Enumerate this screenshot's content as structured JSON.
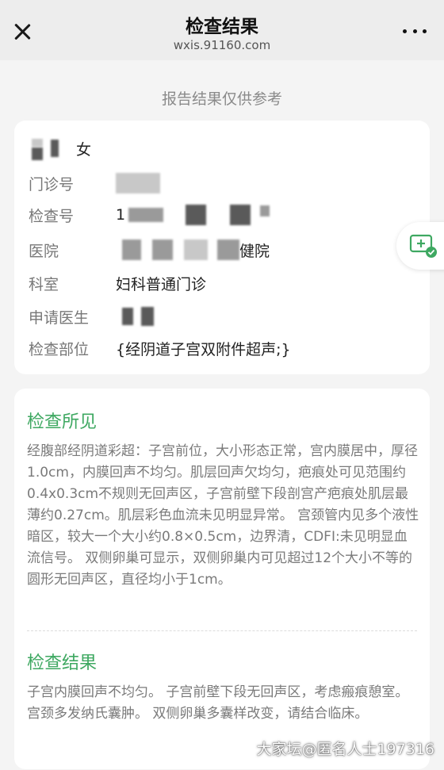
{
  "header": {
    "title": "检查结果",
    "url": "wxis.91160.com"
  },
  "notice": "报告结果仅供参考",
  "patient": {
    "gender": "女",
    "fields": [
      {
        "label": "门诊号",
        "value": ""
      },
      {
        "label": "检查号",
        "value": "1"
      },
      {
        "label": "医院",
        "value": "健院"
      },
      {
        "label": "科室",
        "value": "妇科普通门诊"
      },
      {
        "label": "申请医生",
        "value": ""
      },
      {
        "label": "检查部位",
        "value": "{经阴道子宫双附件超声;}"
      }
    ]
  },
  "findings": {
    "title": "检查所见",
    "text": "经腹部经阴道彩超：子宫前位，大小形态正常，宫内膜居中，厚径1.0cm，内膜回声不均匀。肌层回声欠均匀，疤痕处可见范围约0.4x0.3cm不规则无回声区，子宫前壁下段剖宫产疤痕处肌层最薄约0.27cm。肌层彩色血流未见明显异常。 宫颈管内见多个液性暗区，较大一个大小约0.8×0.5cm，边界清，CDFI:未见明显血流信号。 双侧卵巢可显示，双侧卵巢内可见超过12个大小不等的圆形无回声区，直径均小于1cm。"
  },
  "results": {
    "title": "检查结果",
    "text": "子宫内膜回声不均匀。 子宫前壁下段无回声区，考虑瘢痕憩室。 宫颈多发纳氏囊肿。 双侧卵巢多囊样改变，请结合临床。"
  },
  "watermark": "大家坛@匿名人士197316",
  "colors": {
    "accent": "#3ea861",
    "float_icon": "#3ea861"
  }
}
